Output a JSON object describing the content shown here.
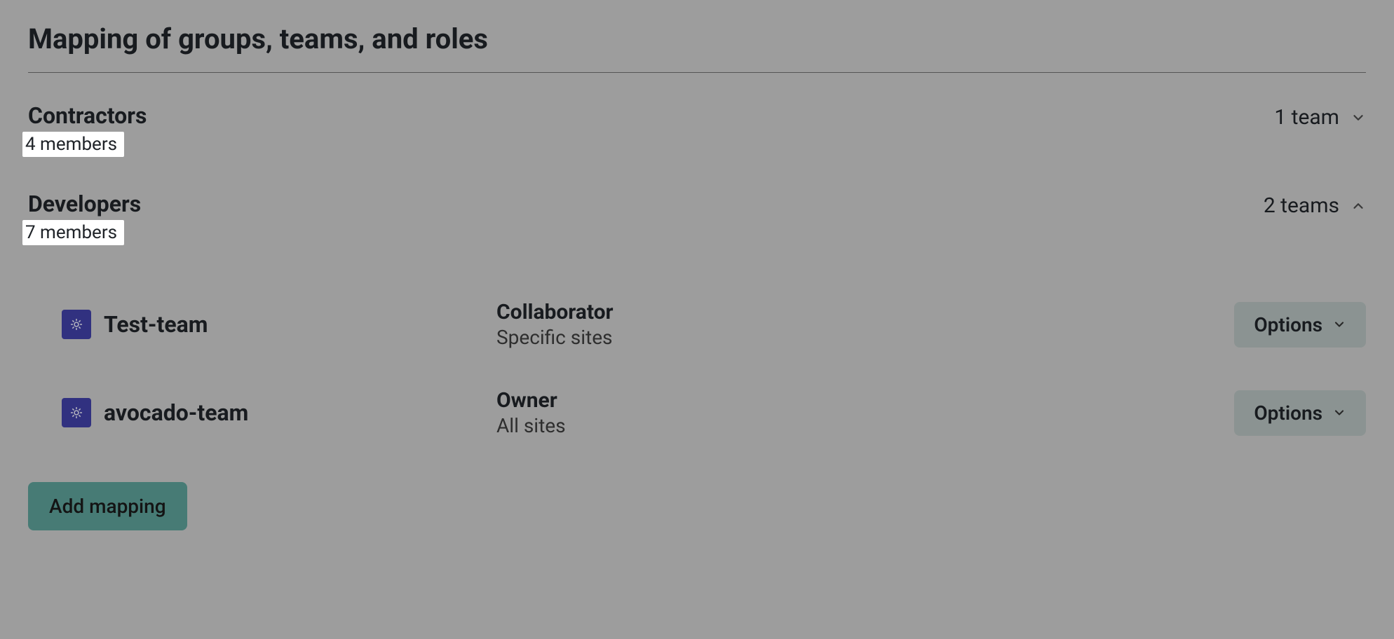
{
  "page_title": "Mapping of groups, teams, and roles",
  "groups": [
    {
      "name": "Contractors",
      "members_label": "4 members",
      "teams_summary": "1 team",
      "expanded": false
    },
    {
      "name": "Developers",
      "members_label": "7 members",
      "teams_summary": "2 teams",
      "expanded": true,
      "teams": [
        {
          "team_name": "Test-team",
          "role": "Collaborator",
          "role_scope": "Specific sites",
          "options_label": "Options"
        },
        {
          "team_name": "avocado-team",
          "role": "Owner",
          "role_scope": "All sites",
          "options_label": "Options"
        }
      ]
    }
  ],
  "add_mapping_label": "Add mapping"
}
